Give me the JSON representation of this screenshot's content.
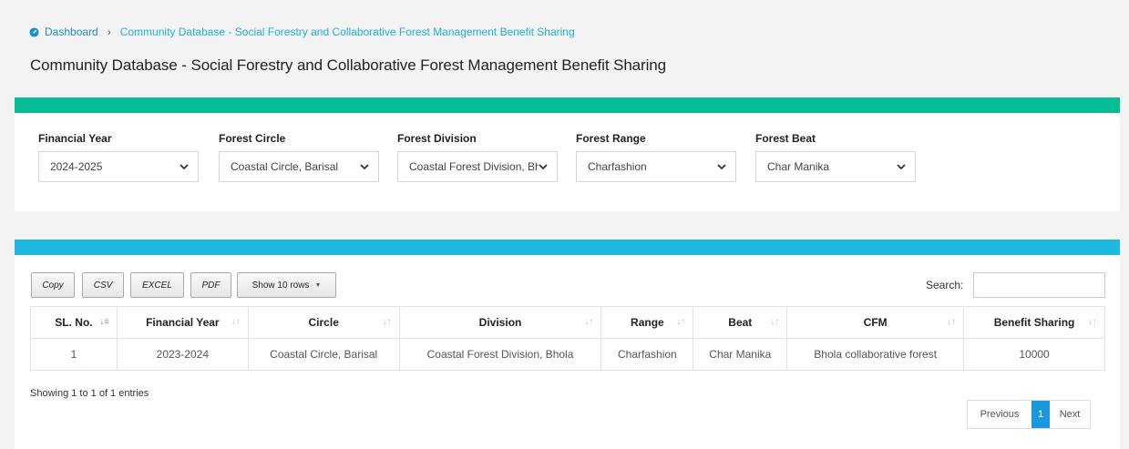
{
  "breadcrumb": {
    "home": "Dashboard",
    "current": "Community Database - Social Forestry and Collaborative Forest Management Benefit Sharing"
  },
  "page": {
    "title": "Community Database - Social Forestry and Collaborative Forest Management Benefit Sharing"
  },
  "colors": {
    "filter_bar": "#07bd96",
    "table_bar": "#1cb8df",
    "link": "#1cb3d6",
    "active_page": "#1b98dc"
  },
  "filters": [
    {
      "label": "Financial Year",
      "value": "2024-2025"
    },
    {
      "label": "Forest Circle",
      "value": "Coastal Circle, Barisal"
    },
    {
      "label": "Forest Division",
      "value": "Coastal Forest Division, Bhola"
    },
    {
      "label": "Forest Range",
      "value": "Charfashion"
    },
    {
      "label": "Forest Beat",
      "value": "Char Manika"
    }
  ],
  "toolbar": {
    "copy": "Copy",
    "csv": "CSV",
    "excel": "EXCEL",
    "pdf": "PDF",
    "rows": "Show 10 rows",
    "search_label": "Search:",
    "search_value": ""
  },
  "table": {
    "headers": [
      "SL. No.",
      "Financial Year",
      "Circle",
      "Division",
      "Range",
      "Beat",
      "CFM",
      "Benefit Sharing"
    ],
    "rows": [
      [
        "1",
        "2023-2024",
        "Coastal Circle, Barisal",
        "Coastal Forest Division, Bhola",
        "Charfashion",
        "Char Manika",
        "Bhola collaborative forest",
        "10000"
      ]
    ]
  },
  "footer": {
    "info": "Showing 1 to 1 of 1 entries",
    "prev": "Previous",
    "page": "1",
    "next": "Next"
  }
}
